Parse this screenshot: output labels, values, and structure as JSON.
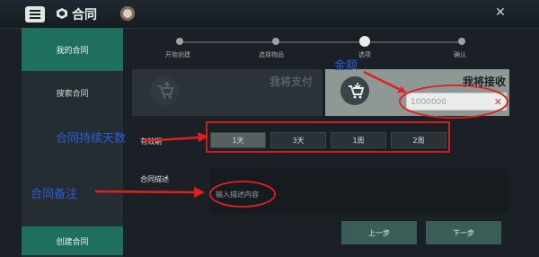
{
  "header": {
    "title": "合同"
  },
  "sidebar": {
    "items": [
      {
        "label": "我的合同"
      },
      {
        "label": "搜索合同"
      }
    ],
    "create_label": "创建合同"
  },
  "steps": [
    {
      "label": "开始创建"
    },
    {
      "label": "选择物品"
    },
    {
      "label": "选项"
    },
    {
      "label": "确认"
    }
  ],
  "pay": {
    "label": "我将支付"
  },
  "receive": {
    "label": "我将接收",
    "amount_value": "1000000"
  },
  "validity": {
    "label": "有效期",
    "options": [
      "1天",
      "3天",
      "1周",
      "2周"
    ],
    "selected": "1天"
  },
  "description": {
    "label": "合同描述",
    "placeholder": "输入描述内容"
  },
  "nav": {
    "prev_label": "上一步",
    "next_label": "下一步"
  },
  "annotations": {
    "amount": "金额",
    "duration": "合同持续天数",
    "remark": "合同备注"
  },
  "colors": {
    "accent": "#1f6f5e",
    "annotation": "#2b5fd8",
    "annotation_arrow": "#e02020"
  }
}
